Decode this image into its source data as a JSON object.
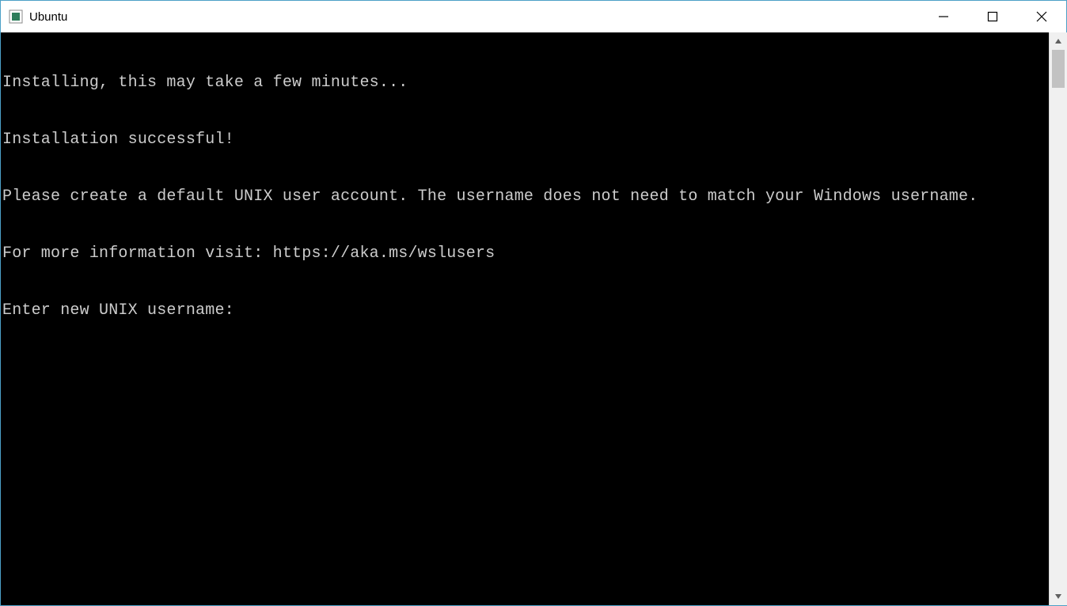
{
  "window": {
    "title": "Ubuntu"
  },
  "terminal": {
    "lines": [
      "Installing, this may take a few minutes...",
      "Installation successful!",
      "Please create a default UNIX user account. The username does not need to match your Windows username.",
      "For more information visit: https://aka.ms/wslusers"
    ],
    "prompt": "Enter new UNIX username:",
    "input_value": ""
  },
  "colors": {
    "window_border": "#4ca0c7",
    "terminal_bg": "#000000",
    "terminal_fg": "#cccccc",
    "scrollbar_bg": "#f0f0f0",
    "scrollbar_thumb": "#c2c2c2"
  }
}
